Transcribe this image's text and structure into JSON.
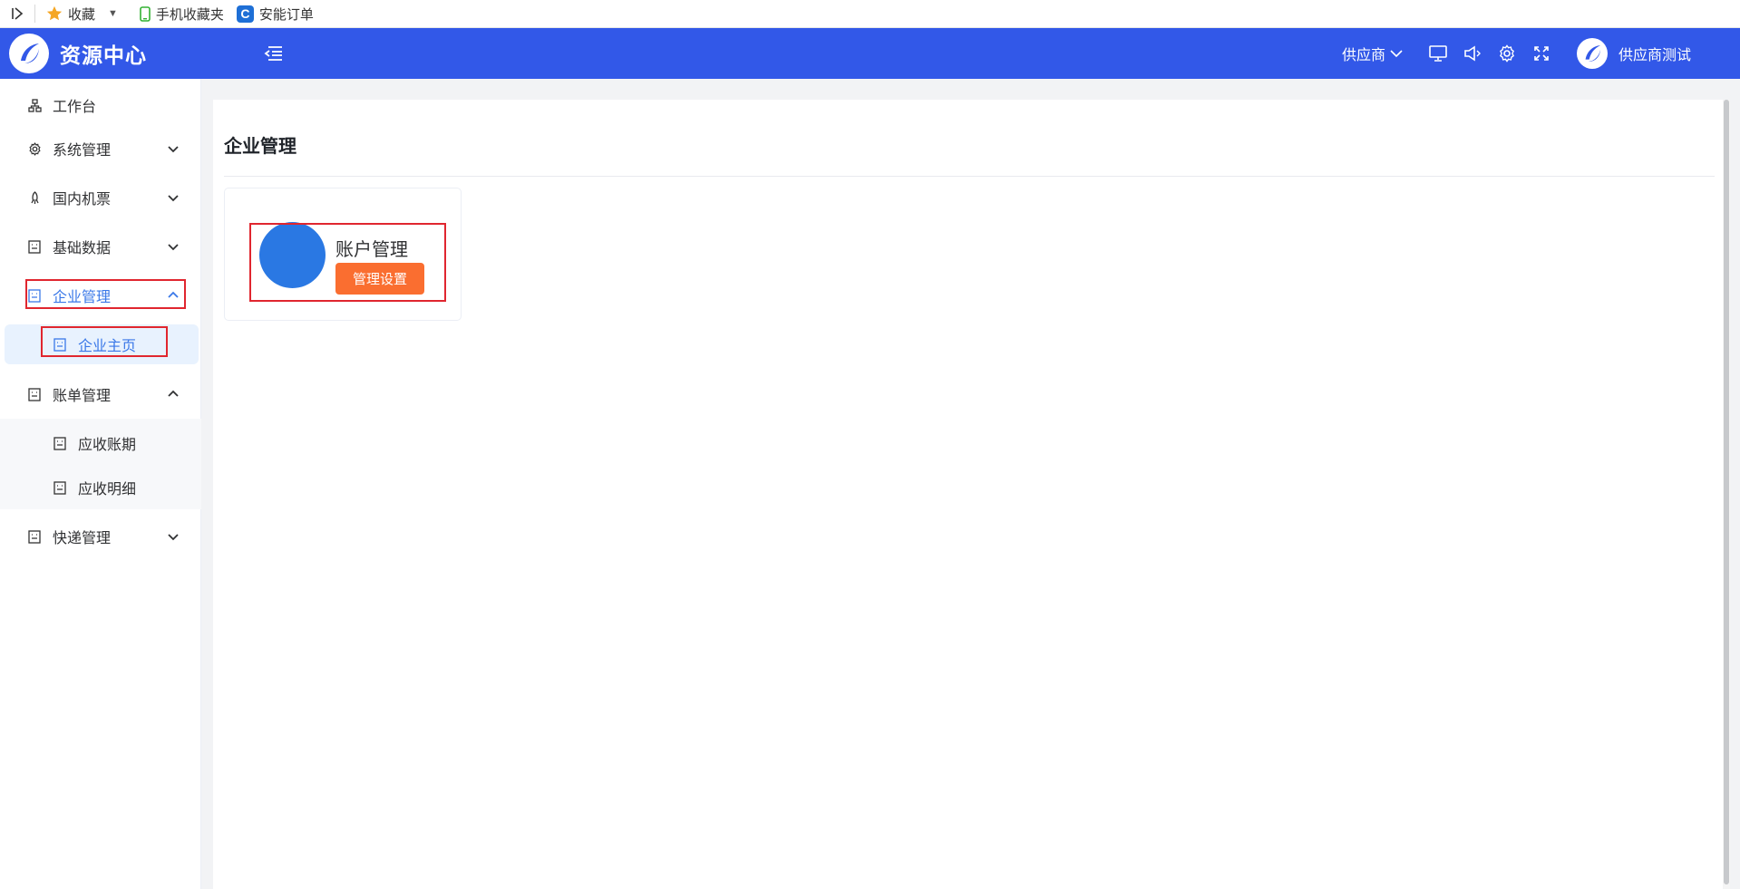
{
  "browser": {
    "bookmarks": [
      {
        "label": "收藏",
        "icon": "star-icon"
      },
      {
        "label": "手机收藏夹",
        "icon": "phone-icon"
      },
      {
        "label": "安能订单",
        "icon": "c-badge-icon"
      }
    ],
    "c_badge_letter": "C"
  },
  "header": {
    "app_title": "资源中心",
    "role_label": "供应商",
    "user_name": "供应商测试",
    "bg_color": "#3258e8"
  },
  "sidebar": {
    "items": [
      {
        "label": "工作台",
        "icon": "workbench-icon"
      },
      {
        "label": "系统管理",
        "icon": "gear-icon",
        "expanded": false
      },
      {
        "label": "国内机票",
        "icon": "rocket-icon",
        "expanded": false
      },
      {
        "label": "基础数据",
        "icon": "doc-icon",
        "expanded": false
      },
      {
        "label": "企业管理",
        "icon": "doc-icon",
        "expanded": true,
        "active": true
      },
      {
        "label": "账单管理",
        "icon": "doc-icon",
        "expanded": true
      },
      {
        "label": "快递管理",
        "icon": "doc-icon",
        "expanded": false
      }
    ],
    "enterprise_sub": [
      {
        "label": "企业主页",
        "active": true
      }
    ],
    "billing_sub": [
      {
        "label": "应收账期"
      },
      {
        "label": "应收明细"
      }
    ]
  },
  "main": {
    "page_title": "企业管理",
    "module": {
      "title": "账户管理",
      "button_label": "管理设置"
    }
  },
  "colors": {
    "accent": "#3a78e8",
    "orange": "#fa6e30",
    "annotation_red": "#e0262f"
  }
}
